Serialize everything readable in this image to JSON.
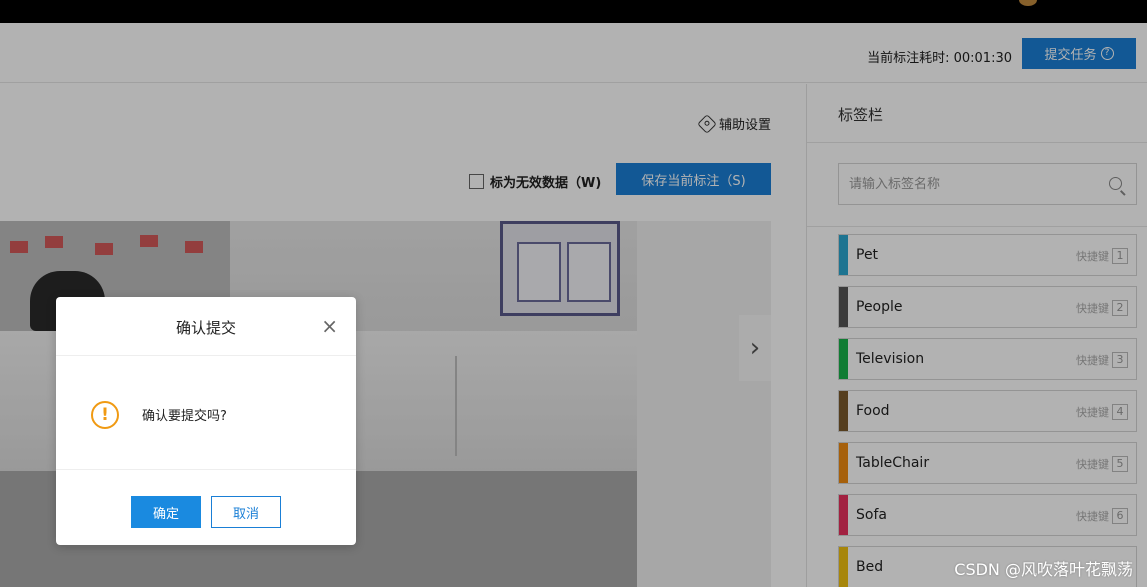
{
  "header": {
    "timer_label": "当前标注耗时: 00:01:30",
    "submit_label": "提交任务",
    "submit_help": "?"
  },
  "toolbar": {
    "assist_label": "辅助设置",
    "invalid_label": "标为无效数据（W)",
    "save_label": "保存当前标注（S)"
  },
  "sidebar": {
    "title": "标签栏",
    "search_placeholder": "请输入标签名称",
    "shortcut_label": "快捷键",
    "tags": [
      {
        "name": "Pet",
        "key": "1",
        "color": "#2aa7d0"
      },
      {
        "name": "People",
        "key": "2",
        "color": "#555555"
      },
      {
        "name": "Television",
        "key": "3",
        "color": "#17b24a"
      },
      {
        "name": "Food",
        "key": "4",
        "color": "#7a5a2c"
      },
      {
        "name": "TableChair",
        "key": "5",
        "color": "#ee8a10"
      },
      {
        "name": "Sofa",
        "key": "6",
        "color": "#e8305e"
      },
      {
        "name": "Bed",
        "key": "",
        "color": "#f0c010"
      }
    ]
  },
  "modal": {
    "title": "确认提交",
    "close": "×",
    "warn_glyph": "!",
    "message": "确认要提交吗?",
    "ok_label": "确定",
    "cancel_label": "取消"
  },
  "canvas": {
    "next_glyph": "›"
  },
  "watermark": "CSDN @风吹落叶花飘荡",
  "colors": {
    "accent": "#1a7fd6",
    "warning": "#f09a13"
  }
}
